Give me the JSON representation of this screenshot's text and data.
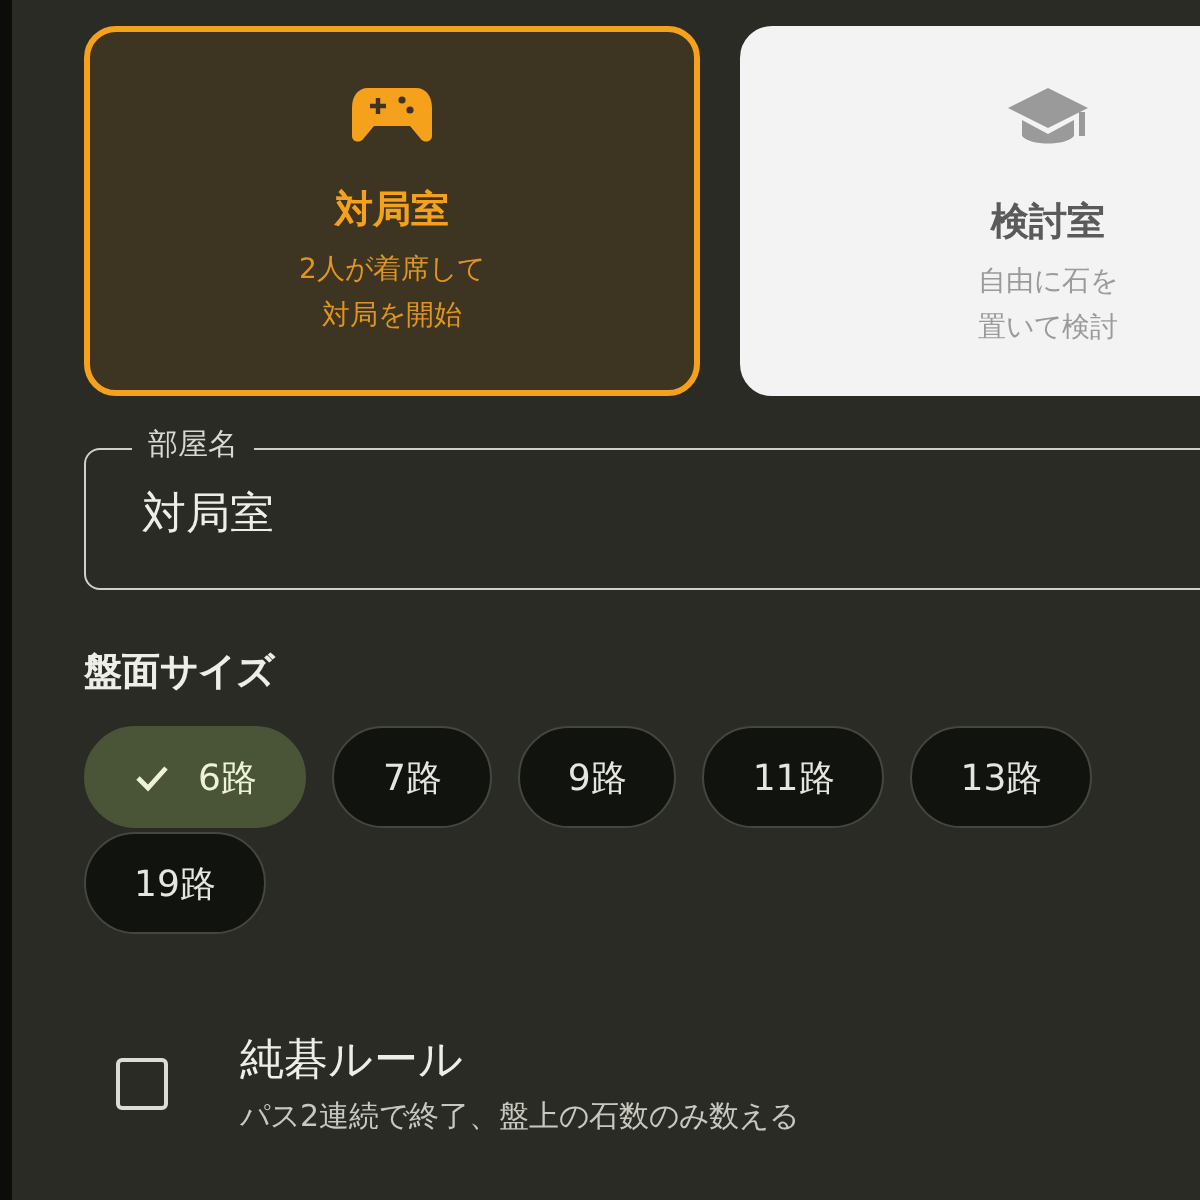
{
  "room_types": [
    {
      "kind": "game",
      "title": "対局室",
      "description": [
        "2人が着席して",
        "対局を開始"
      ],
      "selected": true
    },
    {
      "kind": "study",
      "title": "検討室",
      "description": [
        "自由に石を",
        "置いて検討"
      ],
      "selected": false
    }
  ],
  "room_name": {
    "label": "部屋名",
    "value": "対局室"
  },
  "board_size": {
    "heading": "盤面サイズ",
    "options": [
      {
        "label": "6路",
        "selected": true
      },
      {
        "label": "7路",
        "selected": false
      },
      {
        "label": "9路",
        "selected": false
      },
      {
        "label": "11路",
        "selected": false
      },
      {
        "label": "13路",
        "selected": false
      },
      {
        "label": "19路",
        "selected": false
      }
    ]
  },
  "pure_go": {
    "title": "純碁ルール",
    "description": "パス2連続で終了、盤上の石数のみ数える",
    "checked": false
  }
}
